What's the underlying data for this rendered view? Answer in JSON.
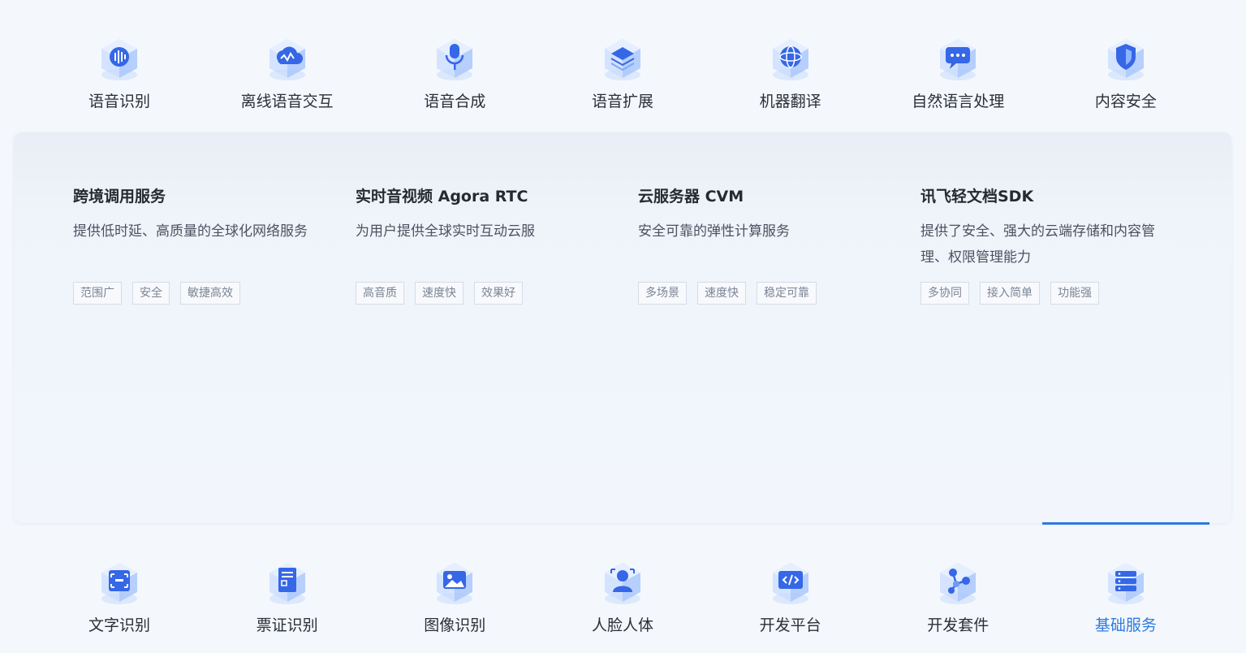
{
  "top_nav": [
    {
      "label": "语音识别",
      "icon": "voice-recognition-icon"
    },
    {
      "label": "离线语音交互",
      "icon": "offline-voice-icon"
    },
    {
      "label": "语音合成",
      "icon": "microphone-icon"
    },
    {
      "label": "语音扩展",
      "icon": "voice-extension-icon"
    },
    {
      "label": "机器翻译",
      "icon": "globe-icon"
    },
    {
      "label": "自然语言处理",
      "icon": "chat-bubble-icon"
    },
    {
      "label": "内容安全",
      "icon": "shield-icon"
    }
  ],
  "bottom_nav": [
    {
      "label": "文字识别",
      "icon": "text-scan-icon"
    },
    {
      "label": "票证识别",
      "icon": "receipt-icon"
    },
    {
      "label": "图像识别",
      "icon": "image-icon"
    },
    {
      "label": "人脸人体",
      "icon": "face-icon"
    },
    {
      "label": "开发平台",
      "icon": "code-screen-icon"
    },
    {
      "label": "开发套件",
      "icon": "molecule-icon"
    },
    {
      "label": "基础服务",
      "icon": "server-stack-icon",
      "active": true
    }
  ],
  "cards": [
    {
      "title": "跨境调用服务",
      "desc": "提供低时延、高质量的全球化网络服务",
      "tags": [
        "范围广",
        "安全",
        "敏捷高效"
      ]
    },
    {
      "title": "实时音视频 Agora RTC",
      "desc": "为用户提供全球实时互动云服",
      "tags": [
        "高音质",
        "速度快",
        "效果好"
      ]
    },
    {
      "title": "云服务器 CVM",
      "desc": "安全可靠的弹性计算服务",
      "tags": [
        "多场景",
        "速度快",
        "稳定可靠"
      ]
    },
    {
      "title": "讯飞轻文档SDK",
      "desc": "提供了安全、强大的云端存储和内容管理、权限管理能力",
      "tags": [
        "多协同",
        "接入简单",
        "功能强"
      ]
    }
  ],
  "colors": {
    "accent": "#2f7ae0",
    "icon_light": "#c9dcff",
    "icon_mid": "#7ea9f5",
    "icon_dark": "#3567e6"
  }
}
